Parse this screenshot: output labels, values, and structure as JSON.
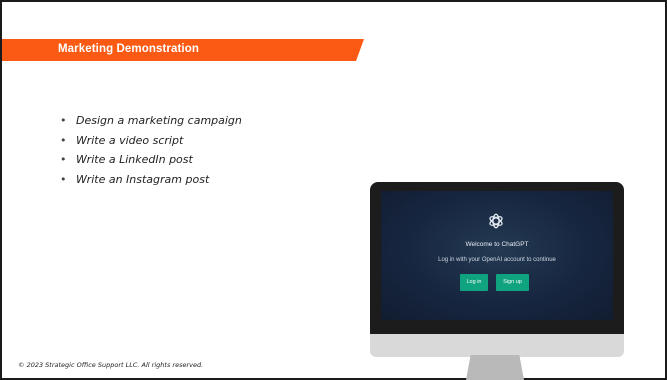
{
  "slide": {
    "title": "Marketing Demonstration",
    "accent_color": "#fa5a13",
    "bullets": [
      "Design a marketing campaign",
      "Write a video script",
      "Write a LinkedIn post",
      "Write an Instagram post"
    ],
    "bullet_glyph": "•",
    "footer": "© 2023 Strategic Office Support LLC.  All rights reserved."
  },
  "monitor": {
    "logo_icon": "openai-logo-icon",
    "welcome": "Welcome to ChatGPT",
    "subtitle": "Log in with your OpenAI account to continue",
    "login_label": "Log in",
    "signup_label": "Sign up",
    "button_color": "#10a37f"
  }
}
